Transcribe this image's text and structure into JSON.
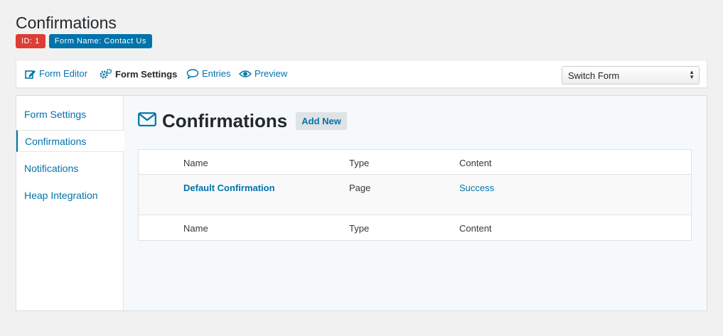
{
  "page": {
    "title": "Confirmations"
  },
  "badges": {
    "id": "ID: 1",
    "form_name": "Form Name: Contact Us"
  },
  "toolbar": {
    "items": [
      {
        "label": "Form Editor",
        "icon": "edit-icon"
      },
      {
        "label": "Form Settings",
        "icon": "gears-icon"
      },
      {
        "label": "Entries",
        "icon": "comment-icon"
      },
      {
        "label": "Preview",
        "icon": "eye-icon"
      }
    ],
    "switch_form": "Switch Form"
  },
  "sidebar": {
    "items": [
      {
        "label": "Form Settings"
      },
      {
        "label": "Confirmations",
        "active": true
      },
      {
        "label": "Notifications"
      },
      {
        "label": "Heap Integration"
      }
    ]
  },
  "main": {
    "heading": "Confirmations",
    "heading_icon": "envelope-icon",
    "add_new": "Add New",
    "columns": [
      "Name",
      "Type",
      "Content"
    ],
    "rows": [
      {
        "name": "Default Confirmation",
        "type": "Page",
        "content": "Success"
      }
    ],
    "footer_columns": [
      "Name",
      "Type",
      "Content"
    ]
  },
  "colors": {
    "accent": "#0073aa",
    "id_badge": "#dd3d36",
    "form_badge": "#0073aa",
    "background": "#f1f1f1"
  }
}
